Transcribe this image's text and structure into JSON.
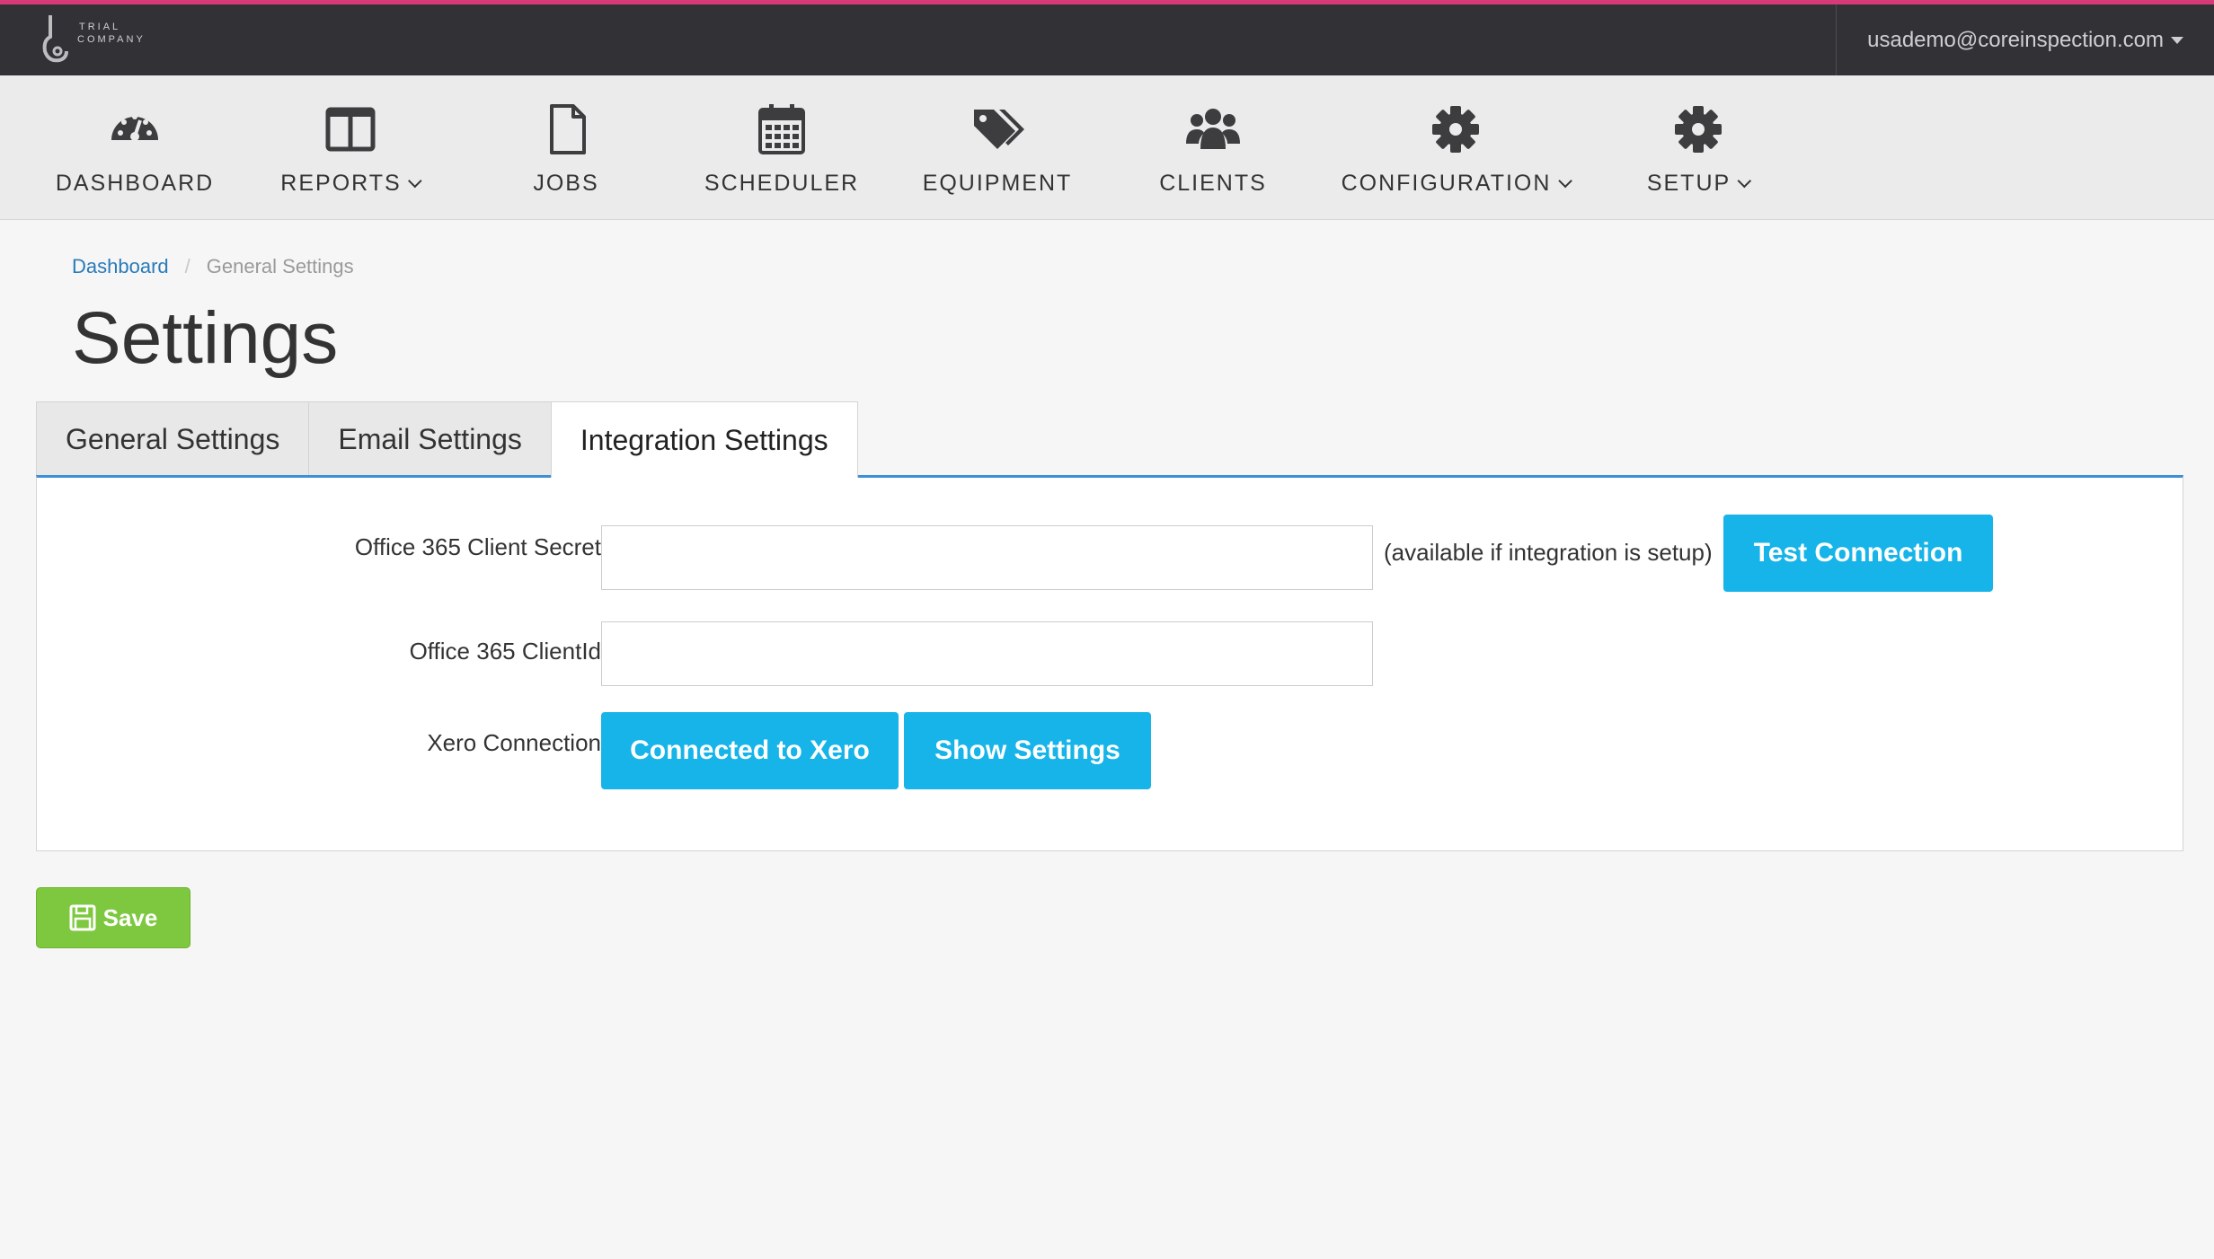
{
  "topbar": {
    "logo_line1": "TRIAL",
    "logo_line2": "COMPANY",
    "user_email": "usademo@coreinspection.com"
  },
  "nav": {
    "items": [
      {
        "label": "DASHBOARD",
        "icon": "dashboard-gauge-icon",
        "dropdown": false
      },
      {
        "label": "REPORTS",
        "icon": "columns-icon",
        "dropdown": true
      },
      {
        "label": "JOBS",
        "icon": "file-icon",
        "dropdown": false
      },
      {
        "label": "SCHEDULER",
        "icon": "calendar-icon",
        "dropdown": false
      },
      {
        "label": "EQUIPMENT",
        "icon": "tags-icon",
        "dropdown": false
      },
      {
        "label": "CLIENTS",
        "icon": "users-icon",
        "dropdown": false
      },
      {
        "label": "CONFIGURATION",
        "icon": "gear-icon",
        "dropdown": true
      },
      {
        "label": "SETUP",
        "icon": "gear-icon",
        "dropdown": true
      }
    ]
  },
  "breadcrumb": {
    "home": "Dashboard",
    "separator": "/",
    "current": "General Settings"
  },
  "page_title": "Settings",
  "tabs": [
    {
      "label": "General Settings",
      "active": false
    },
    {
      "label": "Email Settings",
      "active": false
    },
    {
      "label": "Integration Settings",
      "active": true
    }
  ],
  "form": {
    "client_secret_label": "Office 365 Client Secret",
    "client_secret_value": "",
    "availability_hint": "(available if integration is setup)",
    "test_connection_label": "Test Connection",
    "client_id_label": "Office 365 ClientId",
    "client_id_value": "",
    "xero_label": "Xero Connection",
    "xero_connected_label": "Connected to Xero",
    "show_settings_label": "Show Settings"
  },
  "save_label": "Save",
  "colors": {
    "accent_top": "#d63a78",
    "primary_blue": "#16b4e8",
    "save_green": "#7ec83f",
    "tab_underline": "#3d8fd6",
    "link": "#2a7ab8"
  }
}
